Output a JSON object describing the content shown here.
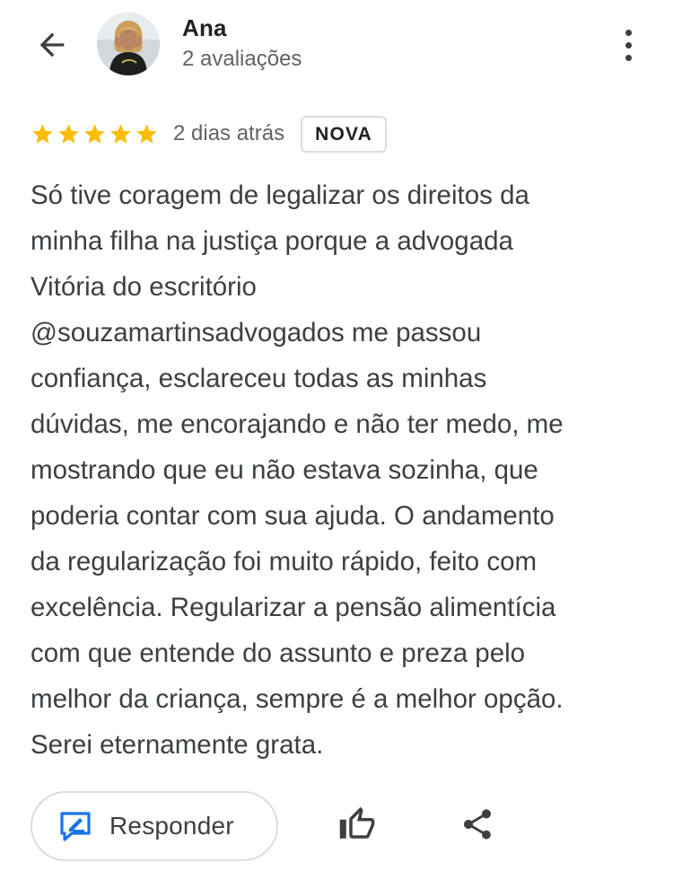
{
  "reviewer": {
    "name": "Ana",
    "review_count": "2 avaliações"
  },
  "review": {
    "rating": 5,
    "date": "2 dias atrás",
    "badge": "NOVA",
    "text_lines": [
      "Só tive coragem de legalizar os direitos da",
      "minha filha na justiça porque a advogada",
      "Vitória do escritório",
      "@souzamartinsadvogados me passou",
      "confiança, esclareceu todas as minhas",
      "dúvidas, me encorajando e não ter medo, me",
      "mostrando que eu não estava sozinha, que",
      "poderia contar com sua ajuda. O andamento",
      "da regularização foi muito rápido, feito com",
      "excelência. Regularizar a pensão alimentícia",
      "com que entende do assunto e preza pelo",
      "melhor da criança, sempre é a melhor opção.",
      "Serei eternamente grata."
    ]
  },
  "actions": {
    "reply_label": "Responder"
  },
  "icons": {
    "back": "arrow-back-icon",
    "more": "more-vert-icon",
    "star": "star-icon",
    "reply": "reply-edit-icon",
    "like": "thumb-up-icon",
    "share": "share-icon"
  },
  "colors": {
    "star": "#fbbc04",
    "reply_icon": "#1a73e8",
    "text": "#3c4043",
    "secondary_text": "#5f6368"
  }
}
